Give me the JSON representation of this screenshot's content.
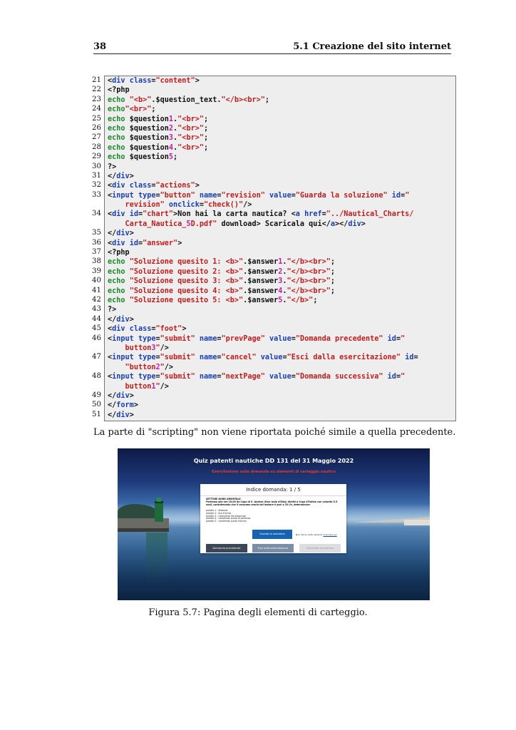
{
  "header": {
    "page_number": "38",
    "section": "5.1 Creazione del sito internet"
  },
  "code": {
    "line_numbers": [
      "21",
      "22",
      "23",
      "24",
      "25",
      "26",
      "27",
      "28",
      "29",
      "30",
      "31",
      "32",
      "33",
      "",
      "34",
      "",
      "35",
      "36",
      "37",
      "38",
      "39",
      "40",
      "41",
      "42",
      "43",
      "44",
      "45",
      "46",
      "",
      "47",
      "",
      "48",
      "",
      "49",
      "50",
      "51"
    ],
    "lines": [
      [
        [
          "tag",
          "<"
        ],
        [
          "attr",
          "div"
        ],
        [
          "tag",
          " "
        ],
        [
          "attr",
          "class"
        ],
        [
          "tag",
          "="
        ],
        [
          "str",
          "\"content\""
        ],
        [
          "tag",
          ">"
        ]
      ],
      [
        [
          "tag",
          "<?php"
        ]
      ],
      [
        [
          "kw",
          "echo"
        ],
        [
          "tag",
          " "
        ],
        [
          "str",
          "\"<b>\""
        ],
        [
          "tag",
          "."
        ],
        [
          "var",
          "$question_text"
        ],
        [
          "tag",
          "."
        ],
        [
          "str",
          "\"</b><br>\""
        ],
        [
          "tag",
          ";"
        ]
      ],
      [
        [
          "kw",
          "echo"
        ],
        [
          "str",
          "\"<br>\""
        ],
        [
          "tag",
          ";"
        ]
      ],
      [
        [
          "kw",
          "echo"
        ],
        [
          "tag",
          " "
        ],
        [
          "var",
          "$question"
        ],
        [
          "num",
          "1"
        ],
        [
          "tag",
          "."
        ],
        [
          "str",
          "\"<br>\""
        ],
        [
          "tag",
          ";"
        ]
      ],
      [
        [
          "kw",
          "echo"
        ],
        [
          "tag",
          " "
        ],
        [
          "var",
          "$question"
        ],
        [
          "num",
          "2"
        ],
        [
          "tag",
          "."
        ],
        [
          "str",
          "\"<br>\""
        ],
        [
          "tag",
          ";"
        ]
      ],
      [
        [
          "kw",
          "echo"
        ],
        [
          "tag",
          " "
        ],
        [
          "var",
          "$question"
        ],
        [
          "num",
          "3"
        ],
        [
          "tag",
          "."
        ],
        [
          "str",
          "\"<br>\""
        ],
        [
          "tag",
          ";"
        ]
      ],
      [
        [
          "kw",
          "echo"
        ],
        [
          "tag",
          " "
        ],
        [
          "var",
          "$question"
        ],
        [
          "num",
          "4"
        ],
        [
          "tag",
          "."
        ],
        [
          "str",
          "\"<br>\""
        ],
        [
          "tag",
          ";"
        ]
      ],
      [
        [
          "kw",
          "echo"
        ],
        [
          "tag",
          " "
        ],
        [
          "var",
          "$question"
        ],
        [
          "num",
          "5"
        ],
        [
          "tag",
          ";"
        ]
      ],
      [
        [
          "tag",
          "?>"
        ]
      ],
      [
        [
          "tag",
          "</"
        ],
        [
          "attr",
          "div"
        ],
        [
          "tag",
          ">"
        ]
      ],
      [
        [
          "tag",
          "<"
        ],
        [
          "attr",
          "div"
        ],
        [
          "tag",
          " "
        ],
        [
          "attr",
          "class"
        ],
        [
          "tag",
          "="
        ],
        [
          "str",
          "\"actions\""
        ],
        [
          "tag",
          ">"
        ]
      ],
      [
        [
          "tag",
          "<"
        ],
        [
          "attr",
          "input"
        ],
        [
          "tag",
          " "
        ],
        [
          "attr",
          "type"
        ],
        [
          "tag",
          "="
        ],
        [
          "str",
          "\"button\""
        ],
        [
          "tag",
          " "
        ],
        [
          "attr",
          "name"
        ],
        [
          "tag",
          "="
        ],
        [
          "str",
          "\"revision\""
        ],
        [
          "tag",
          " "
        ],
        [
          "attr",
          "value"
        ],
        [
          "tag",
          "="
        ],
        [
          "str",
          "\"Guarda la soluzione\""
        ],
        [
          "tag",
          " "
        ],
        [
          "attr",
          "id"
        ],
        [
          "tag",
          "="
        ],
        [
          "str",
          "\""
        ]
      ],
      [
        [
          "tag",
          "    "
        ],
        [
          "str",
          "revision\""
        ],
        [
          "tag",
          " "
        ],
        [
          "attr",
          "onclick"
        ],
        [
          "tag",
          "="
        ],
        [
          "str",
          "\"check()\""
        ],
        [
          "tag",
          "/>"
        ]
      ],
      [
        [
          "tag",
          "<"
        ],
        [
          "attr",
          "div"
        ],
        [
          "tag",
          " "
        ],
        [
          "attr",
          "id"
        ],
        [
          "tag",
          "="
        ],
        [
          "str",
          "\"chart\""
        ],
        [
          "tag",
          ">Non hai la carta nautica? <"
        ],
        [
          "attr",
          "a"
        ],
        [
          "tag",
          " "
        ],
        [
          "attr",
          "href"
        ],
        [
          "tag",
          "="
        ],
        [
          "str",
          "\"../Nautical_Charts/"
        ]
      ],
      [
        [
          "tag",
          "    "
        ],
        [
          "str",
          "Carta_Nautica_"
        ],
        [
          "num",
          "5"
        ],
        [
          "str",
          "D.pdf\""
        ],
        [
          "tag",
          " download> Scaricala qui</"
        ],
        [
          "attr",
          "a"
        ],
        [
          "tag",
          "></"
        ],
        [
          "attr",
          "div"
        ],
        [
          "tag",
          ">"
        ]
      ],
      [
        [
          "tag",
          "</"
        ],
        [
          "attr",
          "div"
        ],
        [
          "tag",
          ">"
        ]
      ],
      [
        [
          "tag",
          "<"
        ],
        [
          "attr",
          "div"
        ],
        [
          "tag",
          " "
        ],
        [
          "attr",
          "id"
        ],
        [
          "tag",
          "="
        ],
        [
          "str",
          "\"answer\""
        ],
        [
          "tag",
          ">"
        ]
      ],
      [
        [
          "tag",
          "<?php"
        ]
      ],
      [
        [
          "kw",
          "echo"
        ],
        [
          "tag",
          " "
        ],
        [
          "str",
          "\"Soluzione quesito 1: <b>\""
        ],
        [
          "tag",
          "."
        ],
        [
          "var",
          "$answer"
        ],
        [
          "num",
          "1"
        ],
        [
          "tag",
          "."
        ],
        [
          "str",
          "\"</b><br>\""
        ],
        [
          "tag",
          ";"
        ]
      ],
      [
        [
          "kw",
          "echo"
        ],
        [
          "tag",
          " "
        ],
        [
          "str",
          "\"Soluzione quesito 2: <b>\""
        ],
        [
          "tag",
          "."
        ],
        [
          "var",
          "$answer"
        ],
        [
          "num",
          "2"
        ],
        [
          "tag",
          "."
        ],
        [
          "str",
          "\"</b><br>\""
        ],
        [
          "tag",
          ";"
        ]
      ],
      [
        [
          "kw",
          "echo"
        ],
        [
          "tag",
          " "
        ],
        [
          "str",
          "\"Soluzione quesito 3: <b>\""
        ],
        [
          "tag",
          "."
        ],
        [
          "var",
          "$answer"
        ],
        [
          "num",
          "3"
        ],
        [
          "tag",
          "."
        ],
        [
          "str",
          "\"</b><br>\""
        ],
        [
          "tag",
          ";"
        ]
      ],
      [
        [
          "kw",
          "echo"
        ],
        [
          "tag",
          " "
        ],
        [
          "str",
          "\"Soluzione quesito 4: <b>\""
        ],
        [
          "tag",
          "."
        ],
        [
          "var",
          "$answer"
        ],
        [
          "num",
          "4"
        ],
        [
          "tag",
          "."
        ],
        [
          "str",
          "\"</b><br>\""
        ],
        [
          "tag",
          ";"
        ]
      ],
      [
        [
          "kw",
          "echo"
        ],
        [
          "tag",
          " "
        ],
        [
          "str",
          "\"Soluzione quesito 5: <b>\""
        ],
        [
          "tag",
          "."
        ],
        [
          "var",
          "$answer"
        ],
        [
          "num",
          "5"
        ],
        [
          "tag",
          "."
        ],
        [
          "str",
          "\"</b>\""
        ],
        [
          "tag",
          ";"
        ]
      ],
      [
        [
          "tag",
          "?>"
        ]
      ],
      [
        [
          "tag",
          "</"
        ],
        [
          "attr",
          "div"
        ],
        [
          "tag",
          ">"
        ]
      ],
      [
        [
          "tag",
          "<"
        ],
        [
          "attr",
          "div"
        ],
        [
          "tag",
          " "
        ],
        [
          "attr",
          "class"
        ],
        [
          "tag",
          "="
        ],
        [
          "str",
          "\"foot\""
        ],
        [
          "tag",
          ">"
        ]
      ],
      [
        [
          "tag",
          "<"
        ],
        [
          "attr",
          "input"
        ],
        [
          "tag",
          " "
        ],
        [
          "attr",
          "type"
        ],
        [
          "tag",
          "="
        ],
        [
          "str",
          "\"submit\""
        ],
        [
          "tag",
          " "
        ],
        [
          "attr",
          "name"
        ],
        [
          "tag",
          "="
        ],
        [
          "str",
          "\"prevPage\""
        ],
        [
          "tag",
          " "
        ],
        [
          "attr",
          "value"
        ],
        [
          "tag",
          "="
        ],
        [
          "str",
          "\"Domanda precedente\""
        ],
        [
          "tag",
          " "
        ],
        [
          "attr",
          "id"
        ],
        [
          "tag",
          "="
        ],
        [
          "str",
          "\""
        ]
      ],
      [
        [
          "tag",
          "    "
        ],
        [
          "str",
          "button"
        ],
        [
          "num",
          "3"
        ],
        [
          "str",
          "\""
        ],
        [
          "tag",
          "/>"
        ]
      ],
      [
        [
          "tag",
          "<"
        ],
        [
          "attr",
          "input"
        ],
        [
          "tag",
          " "
        ],
        [
          "attr",
          "type"
        ],
        [
          "tag",
          "="
        ],
        [
          "str",
          "\"submit\""
        ],
        [
          "tag",
          " "
        ],
        [
          "attr",
          "name"
        ],
        [
          "tag",
          "="
        ],
        [
          "str",
          "\"cancel\""
        ],
        [
          "tag",
          " "
        ],
        [
          "attr",
          "value"
        ],
        [
          "tag",
          "="
        ],
        [
          "str",
          "\"Esci dalla esercitazione\""
        ],
        [
          "tag",
          " "
        ],
        [
          "attr",
          "id"
        ],
        [
          "tag",
          "="
        ]
      ],
      [
        [
          "tag",
          "    "
        ],
        [
          "str",
          "\"button"
        ],
        [
          "num",
          "2"
        ],
        [
          "str",
          "\""
        ],
        [
          "tag",
          "/>"
        ]
      ],
      [
        [
          "tag",
          "<"
        ],
        [
          "attr",
          "input"
        ],
        [
          "tag",
          " "
        ],
        [
          "attr",
          "type"
        ],
        [
          "tag",
          "="
        ],
        [
          "str",
          "\"submit\""
        ],
        [
          "tag",
          " "
        ],
        [
          "attr",
          "name"
        ],
        [
          "tag",
          "="
        ],
        [
          "str",
          "\"nextPage\""
        ],
        [
          "tag",
          " "
        ],
        [
          "attr",
          "value"
        ],
        [
          "tag",
          "="
        ],
        [
          "str",
          "\"Domanda successiva\""
        ],
        [
          "tag",
          " "
        ],
        [
          "attr",
          "id"
        ],
        [
          "tag",
          "="
        ],
        [
          "str",
          "\""
        ]
      ],
      [
        [
          "tag",
          "    "
        ],
        [
          "str",
          "button"
        ],
        [
          "num",
          "1"
        ],
        [
          "str",
          "\""
        ],
        [
          "tag",
          "/>"
        ]
      ],
      [
        [
          "tag",
          "</"
        ],
        [
          "attr",
          "div"
        ],
        [
          "tag",
          ">"
        ]
      ],
      [
        [
          "tag",
          "</"
        ],
        [
          "attr",
          "form"
        ],
        [
          "tag",
          ">"
        ]
      ],
      [
        [
          "tag",
          "</"
        ],
        [
          "attr",
          "div"
        ],
        [
          "tag",
          ">"
        ]
      ]
    ]
  },
  "paragraph": "La parte di \"scripting\" non viene riportata poiché simile a quella precedente.",
  "screenshot": {
    "title": "Quiz patenti nautiche DD 131 del 31 Maggio 2022",
    "subtitle": "Esercitazione sulle domande su elementi di carteggio nautico",
    "card_heading": "Indice domanda: 1 / 5",
    "question_bold": "SETTORE NORD ORIENTALE",
    "question_text": "Partenza alle ore 10:00 da Capo di S. Andrea (faro isola d'Elba) diretti a Capo d'Enfola con velocità 5.5 nodi, considerando che il consumo orario del motore è pari a 10 l/h, determinare:",
    "items": [
      "quesito 1 : distanza",
      "quesito 2 : ora d'arrivo",
      "quesito 3 : carburante da imbarcare",
      "quesito 4 : coordinate punto di partenza",
      "quesito 5 : coordinate punto d'arrivo"
    ],
    "solution_button": "Guarda la soluzione",
    "chart_text": "Non hai la carta nautica?",
    "chart_link": "Scaricala qui",
    "prev_button": "Domanda precedente",
    "exit_button": "Esci dalla esercitazione",
    "next_button": "Domanda successiva"
  },
  "caption": "Figura 5.7: Pagina degli elementi di carteggio.",
  "colors": {
    "code_attr": "#1a3fb5",
    "code_string": "#c41c1c",
    "code_keyword": "#1a8a2a",
    "code_number": "#c81ca3",
    "solution_button": "#1763b3",
    "subtitle_red": "#e03b2e"
  }
}
